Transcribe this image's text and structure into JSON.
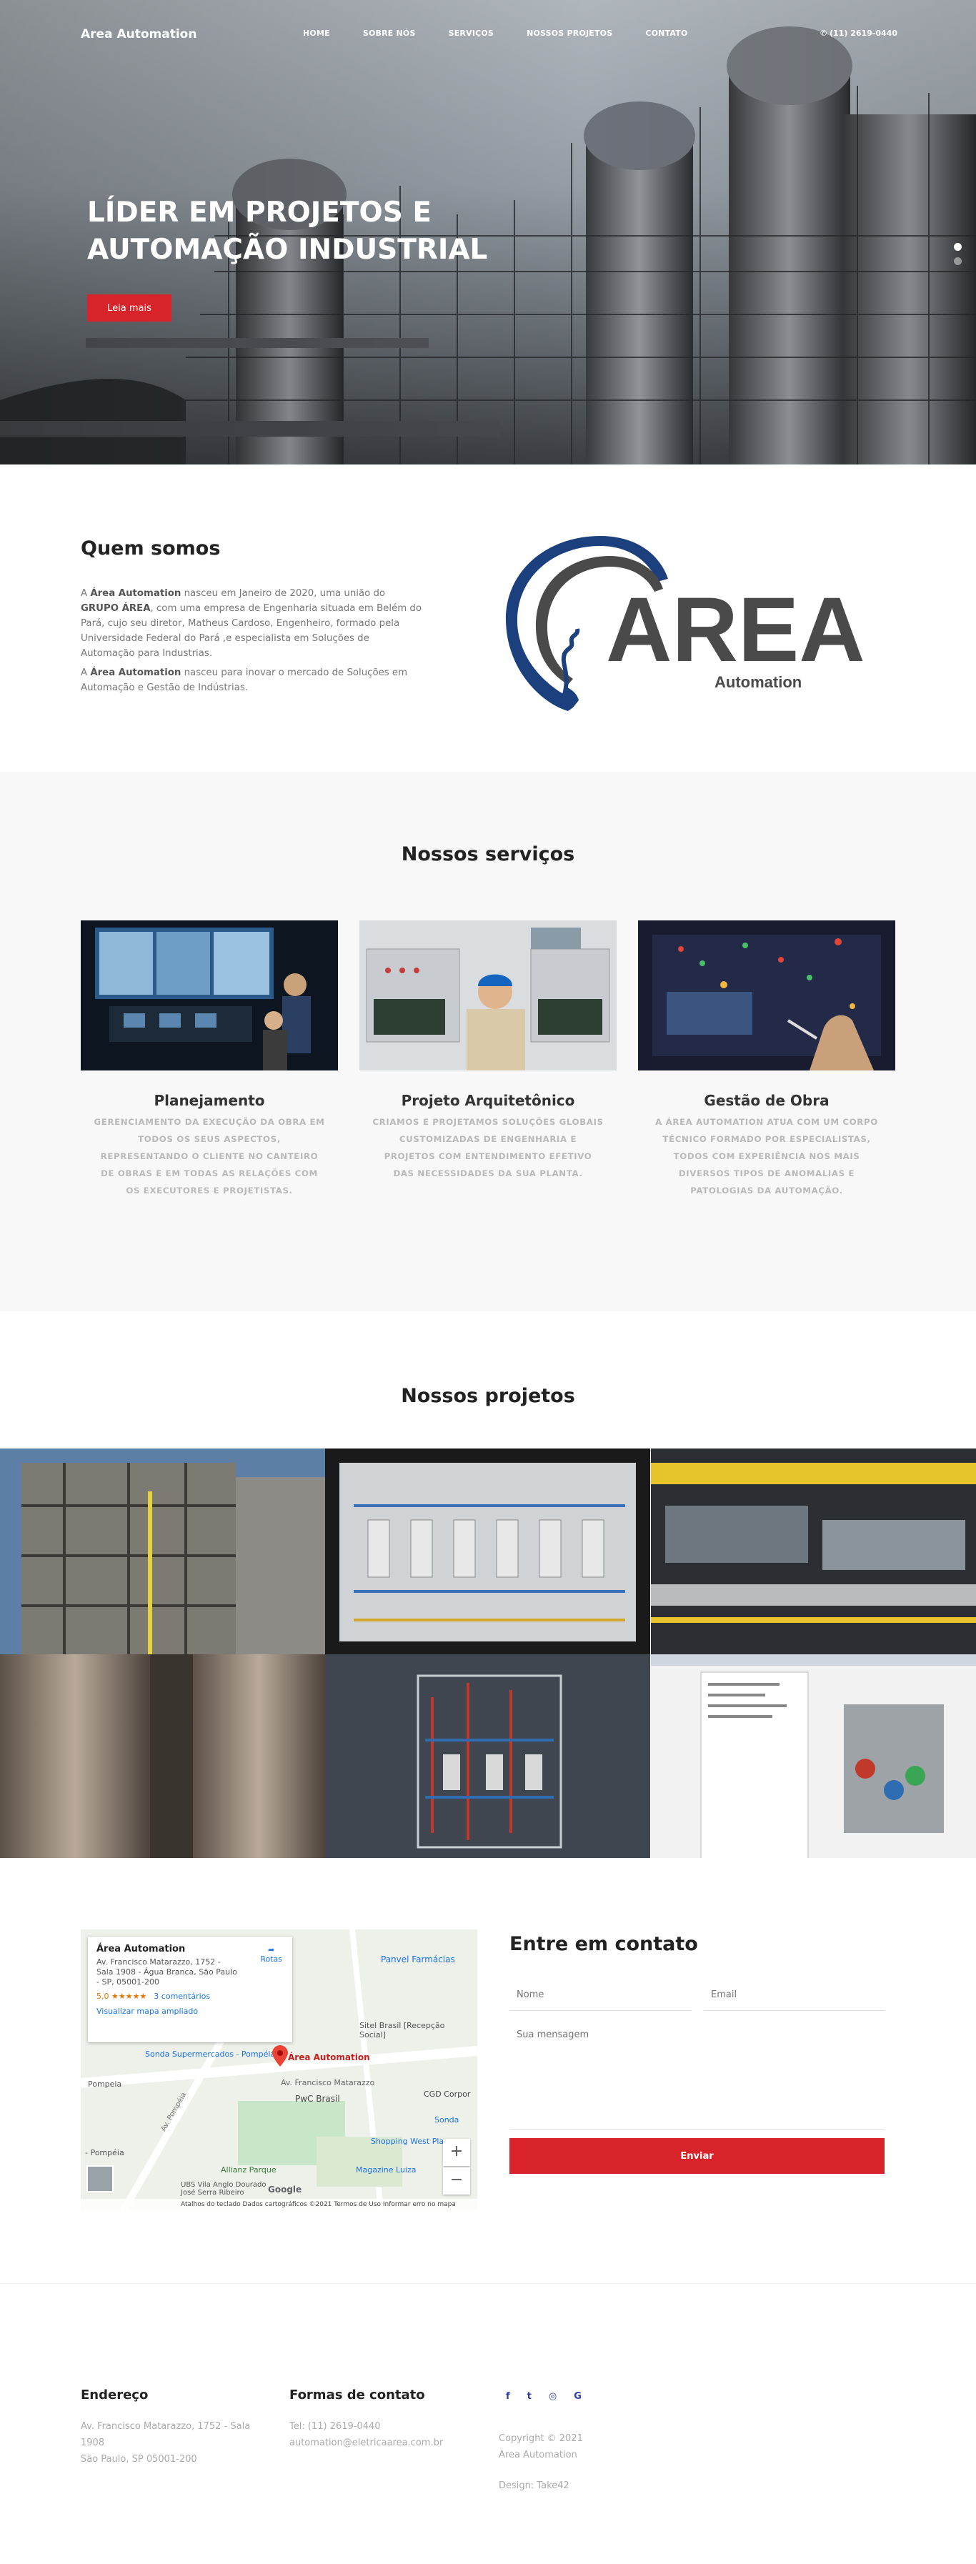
{
  "nav": {
    "brand": "Area Automation",
    "items": [
      "HOME",
      "SOBRE NÓS",
      "SERVIÇOS",
      "NOSSOS PROJETOS",
      "CONTATO"
    ],
    "phone": "(11) 2619-0440"
  },
  "hero": {
    "title_line1": "LÍDER EM PROJETOS E",
    "title_line2": "AUTOMAÇÃO INDUSTRIAL",
    "button": "Leia mais"
  },
  "about": {
    "title": "Quem somos",
    "p1_a": "A ",
    "p1_b": "Área Automation",
    "p1_c": " nasceu em Janeiro de 2020, uma união do ",
    "p1_d": "GRUPO ÁREA",
    "p1_e": ", com uma empresa de Engenharia situada em Belém do Pará, cujo seu diretor, Matheus Cardoso, Engenheiro, formado pela Universidade Federal do Pará ,e especialista em Soluções de Automação para Industrias.",
    "p2_a": "A ",
    "p2_b": "Área Automation",
    "p2_c": " nasceu para inovar o mercado de Soluções em Automação e Gestão de Indústrias.",
    "logo_word": "AREA",
    "logo_sub": "Automation"
  },
  "services": {
    "title": "Nossos serviços",
    "items": [
      {
        "title": "Planejamento",
        "text": "Gerenciamento da execução da obra em todos os seus aspectos, representando o cliente no canteiro de obras e em todas as relações com os executores e projetistas."
      },
      {
        "title": "Projeto Arquitetônico",
        "text": "Criamos e projetamos soluções globais customizadas de engenharia e projetos com entendimento efetivo das necessidades da sua planta."
      },
      {
        "title": "Gestão de Obra",
        "text": "A Área Automation atua com um corpo técnico formado por especialistas, todos com experiência nos mais diversos tipos de anomalias e patologias da automação."
      }
    ]
  },
  "projects": {
    "title": "Nossos projetos"
  },
  "contact": {
    "title": "Entre em contato",
    "name_placeholder": "Nome",
    "email_placeholder": "Email",
    "message_placeholder": "Sua mensagem",
    "send": "Enviar",
    "map": {
      "place": "Área Automation",
      "address": "Av. Francisco Matarazzo, 1752 - Sala 1908 - Água Branca, São Paulo - SP, 05001-200",
      "rating": "5,0 ★★★★★",
      "reviews": "3 comentários",
      "larger_map": "Visualizar mapa ampliado",
      "directions": "Rotas",
      "pin_label": "Área Automation",
      "labels": [
        "Panvel Farmácias",
        "Sitel Brasil [Recepção Social]",
        "Sonda Supermercados - Pompéia",
        "Pompeia",
        "Av. Francisco Matarazzo",
        "PwC Brasil",
        "CGD Corpor",
        "Sonda",
        "Shopping West Plaza",
        "Allianz Parque",
        "Magazine Luiza",
        "- Pompéia",
        "UBS Vila Anglo Dourado José Serra Ribeiro",
        "Av. Pompéia",
        "Google"
      ],
      "footer": "Atalhos do teclado   Dados cartográficos ©2021   Termos de Uso   Informar erro no mapa"
    }
  },
  "footer": {
    "address_title": "Endereço",
    "address_lines": [
      "Av. Francisco Matarazzo, 1752 - Sala",
      "1908",
      "São Paulo, SP 05001-200"
    ],
    "contact_title": "Formas de contato",
    "phone": "Tel: (11) 2619-0440",
    "email": "automation@eletricaarea.com.br",
    "social": [
      "f",
      "t",
      "◎",
      "G"
    ],
    "copyright": "Copyright © 2021",
    "company": "Area Automation",
    "design": "Design: Take42"
  },
  "colors": {
    "accent": "#d8232a",
    "logo_blue": "#1c3f7e",
    "logo_gray": "#4a4a4a"
  }
}
